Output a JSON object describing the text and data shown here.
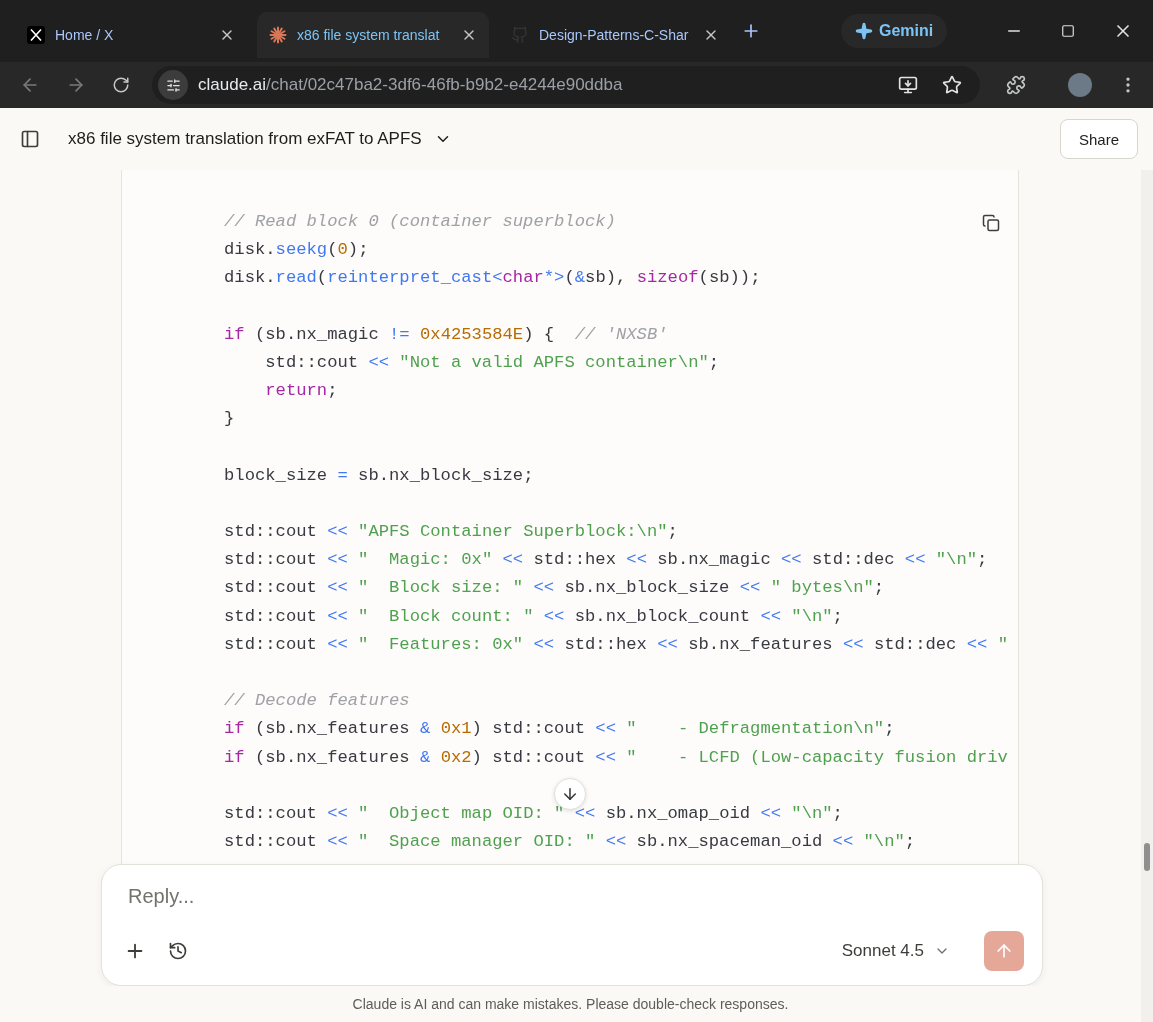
{
  "browser": {
    "tabs": [
      {
        "title": "Home / X",
        "kind": "x",
        "selected": false
      },
      {
        "title": "x86 file system translat",
        "kind": "spark",
        "selected": true
      },
      {
        "title": "Design-Patterns-C-Shar",
        "kind": "github",
        "selected": false
      }
    ],
    "gemini_button": "Gemini",
    "address": {
      "host": "claude.ai",
      "path": "/chat/02c47ba2-3df6-46fb-b9b2-e4244e90ddba"
    }
  },
  "header": {
    "title": "x86 file system translation from exFAT to APFS",
    "share_button": "Share"
  },
  "code_blocks": [
    {
      "lines": [
        [
          {
            "kind": "comment",
            "text": "// Read block 0 (container superblock)"
          }
        ],
        [
          {
            "kind": "plain",
            "text": "disk."
          },
          {
            "kind": "function",
            "text": "seekg"
          },
          {
            "kind": "plain",
            "text": "("
          },
          {
            "kind": "number",
            "text": "0"
          },
          {
            "kind": "plain",
            "text": ");"
          }
        ],
        [
          {
            "kind": "plain",
            "text": "disk."
          },
          {
            "kind": "function",
            "text": "read"
          },
          {
            "kind": "plain",
            "text": "("
          },
          {
            "kind": "function",
            "text": "reinterpret_cast"
          },
          {
            "kind": "operator",
            "text": "<"
          },
          {
            "kind": "keyword",
            "text": "char"
          },
          {
            "kind": "operator",
            "text": "*>"
          },
          {
            "kind": "plain",
            "text": "("
          },
          {
            "kind": "operator",
            "text": "&"
          },
          {
            "kind": "plain",
            "text": "sb), "
          },
          {
            "kind": "keyword",
            "text": "sizeof"
          },
          {
            "kind": "plain",
            "text": "(sb));"
          }
        ]
      ]
    },
    {
      "lines": [
        [
          {
            "kind": "keyword",
            "text": "if"
          },
          {
            "kind": "plain",
            "text": " (sb.nx_magic "
          },
          {
            "kind": "operator",
            "text": "!="
          },
          {
            "kind": "number",
            "text": " 0x4253584E"
          },
          {
            "kind": "plain",
            "text": ") {  "
          },
          {
            "kind": "comment",
            "text": "// 'NXSB'"
          }
        ],
        [
          {
            "kind": "plain",
            "text": "    std::cout "
          },
          {
            "kind": "operator",
            "text": "<<"
          },
          {
            "kind": "string",
            "text": " \"Not a valid APFS container\\n\""
          },
          {
            "kind": "plain",
            "text": ";"
          }
        ],
        [
          {
            "kind": "keyword",
            "text": "    return"
          },
          {
            "kind": "plain",
            "text": ";"
          }
        ],
        [
          {
            "kind": "plain",
            "text": "}"
          }
        ]
      ]
    },
    {
      "lines": [
        [
          {
            "kind": "plain",
            "text": "block_size "
          },
          {
            "kind": "operator",
            "text": "="
          },
          {
            "kind": "plain",
            "text": " sb.nx_block_size;"
          }
        ]
      ]
    },
    {
      "lines": [
        [
          {
            "kind": "plain",
            "text": "std::cout "
          },
          {
            "kind": "operator",
            "text": "<<"
          },
          {
            "kind": "string",
            "text": " \"APFS Container Superblock:\\n\""
          },
          {
            "kind": "plain",
            "text": ";"
          }
        ],
        [
          {
            "kind": "plain",
            "text": "std::cout "
          },
          {
            "kind": "operator",
            "text": "<<"
          },
          {
            "kind": "string",
            "text": " \"  Magic: 0x\""
          },
          {
            "kind": "operator",
            "text": " <<"
          },
          {
            "kind": "plain",
            "text": " std::hex "
          },
          {
            "kind": "operator",
            "text": "<<"
          },
          {
            "kind": "plain",
            "text": " sb.nx_magic "
          },
          {
            "kind": "operator",
            "text": "<<"
          },
          {
            "kind": "plain",
            "text": " std::dec "
          },
          {
            "kind": "operator",
            "text": "<<"
          },
          {
            "kind": "string",
            "text": " \"\\n\""
          },
          {
            "kind": "plain",
            "text": ";"
          }
        ],
        [
          {
            "kind": "plain",
            "text": "std::cout "
          },
          {
            "kind": "operator",
            "text": "<<"
          },
          {
            "kind": "string",
            "text": " \"  Block size: \""
          },
          {
            "kind": "operator",
            "text": " <<"
          },
          {
            "kind": "plain",
            "text": " sb.nx_block_size "
          },
          {
            "kind": "operator",
            "text": "<<"
          },
          {
            "kind": "string",
            "text": " \" bytes\\n\""
          },
          {
            "kind": "plain",
            "text": ";"
          }
        ],
        [
          {
            "kind": "plain",
            "text": "std::cout "
          },
          {
            "kind": "operator",
            "text": "<<"
          },
          {
            "kind": "string",
            "text": " \"  Block count: \""
          },
          {
            "kind": "operator",
            "text": " <<"
          },
          {
            "kind": "plain",
            "text": " sb.nx_block_count "
          },
          {
            "kind": "operator",
            "text": "<<"
          },
          {
            "kind": "string",
            "text": " \"\\n\""
          },
          {
            "kind": "plain",
            "text": ";"
          }
        ],
        [
          {
            "kind": "plain",
            "text": "std::cout "
          },
          {
            "kind": "operator",
            "text": "<<"
          },
          {
            "kind": "string",
            "text": " \"  Features: 0x\""
          },
          {
            "kind": "operator",
            "text": " <<"
          },
          {
            "kind": "plain",
            "text": " std::hex "
          },
          {
            "kind": "operator",
            "text": "<<"
          },
          {
            "kind": "plain",
            "text": " sb.nx_features "
          },
          {
            "kind": "operator",
            "text": "<<"
          },
          {
            "kind": "plain",
            "text": " std::dec "
          },
          {
            "kind": "operator",
            "text": "<<"
          },
          {
            "kind": "string",
            "text": " \""
          }
        ]
      ]
    },
    {
      "lines": [
        [
          {
            "kind": "comment",
            "text": "// Decode features"
          }
        ],
        [
          {
            "kind": "keyword",
            "text": "if"
          },
          {
            "kind": "plain",
            "text": " (sb.nx_features "
          },
          {
            "kind": "operator",
            "text": "&"
          },
          {
            "kind": "number",
            "text": " 0x1"
          },
          {
            "kind": "plain",
            "text": ") std::cout "
          },
          {
            "kind": "operator",
            "text": "<<"
          },
          {
            "kind": "string",
            "text": " \"    - Defragmentation\\n\""
          },
          {
            "kind": "plain",
            "text": ";"
          }
        ],
        [
          {
            "kind": "keyword",
            "text": "if"
          },
          {
            "kind": "plain",
            "text": " (sb.nx_features "
          },
          {
            "kind": "operator",
            "text": "&"
          },
          {
            "kind": "number",
            "text": " 0x2"
          },
          {
            "kind": "plain",
            "text": ") std::cout "
          },
          {
            "kind": "operator",
            "text": "<<"
          },
          {
            "kind": "string",
            "text": " \"    - LCFD (Low-capacity fusion driv"
          }
        ]
      ]
    },
    {
      "scroll_button": true,
      "lines": [
        [
          {
            "kind": "plain",
            "text": "std::cout "
          },
          {
            "kind": "operator",
            "text": "<<"
          },
          {
            "kind": "string",
            "text": " \"  Object map OID: \""
          },
          {
            "kind": "operator",
            "text": " <<"
          },
          {
            "kind": "plain",
            "text": " sb.nx_omap_oid "
          },
          {
            "kind": "operator",
            "text": "<<"
          },
          {
            "kind": "string",
            "text": " \"\\n\""
          },
          {
            "kind": "plain",
            "text": ";"
          }
        ],
        [
          {
            "kind": "plain",
            "text": "std::cout "
          },
          {
            "kind": "operator",
            "text": "<<"
          },
          {
            "kind": "string",
            "text": " \"  Space manager OID: \""
          },
          {
            "kind": "operator",
            "text": " <<"
          },
          {
            "kind": "plain",
            "text": " sb.nx_spaceman_oid "
          },
          {
            "kind": "operator",
            "text": "<<"
          },
          {
            "kind": "string",
            "text": " \"\\n\""
          },
          {
            "kind": "plain",
            "text": ";"
          }
        ]
      ]
    }
  ],
  "composer": {
    "placeholder": "Reply...",
    "model": "Sonnet 4.5"
  },
  "disclaimer": "Claude is AI and can make mistakes. Please double-check responses."
}
